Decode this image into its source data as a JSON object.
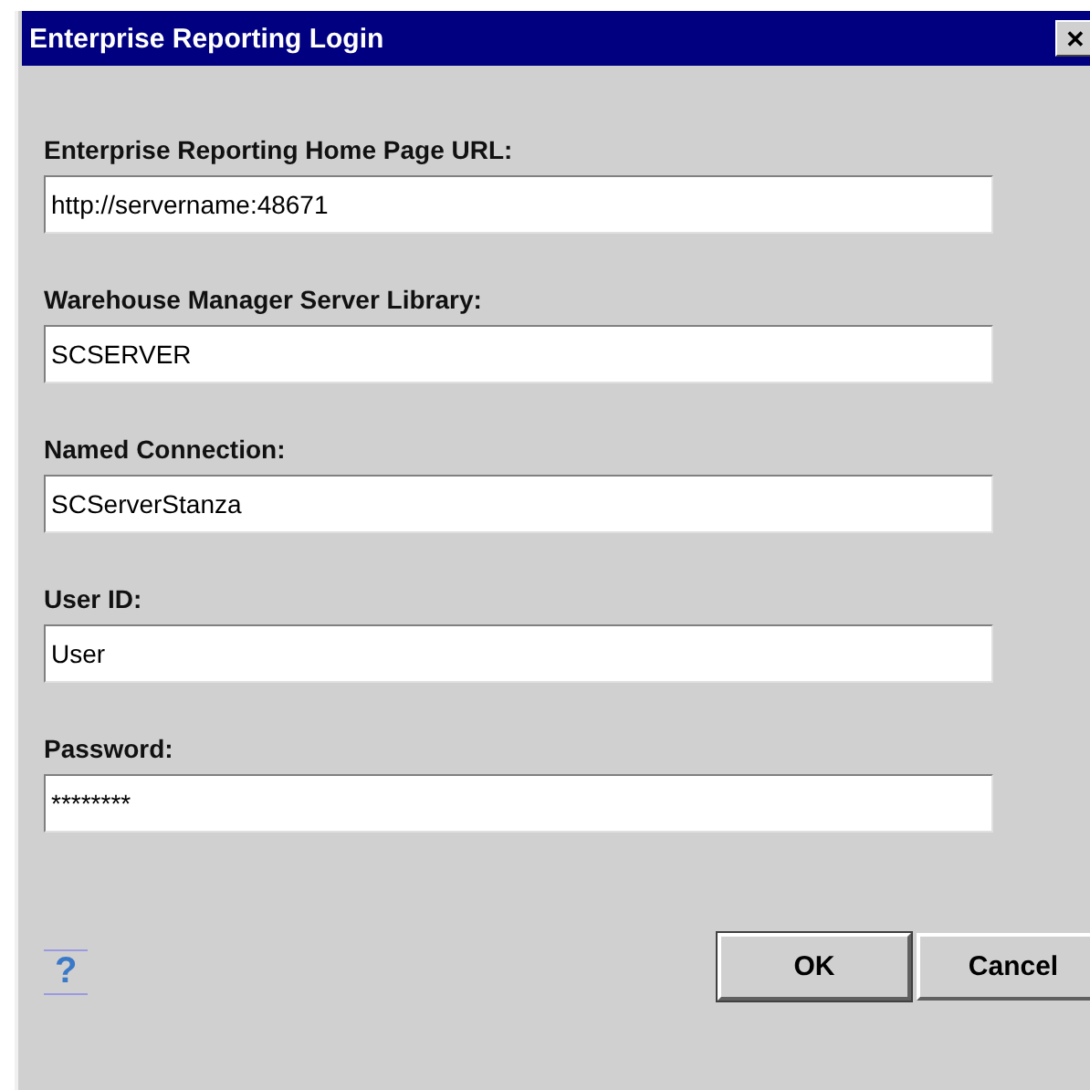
{
  "window": {
    "title": "Enterprise Reporting Login",
    "close": "✕"
  },
  "fields": [
    {
      "label": "Enterprise Reporting Home Page URL:",
      "value": "http://servername:48671"
    },
    {
      "label": "Warehouse Manager Server Library:",
      "value": "SCSERVER"
    },
    {
      "label": "Named Connection:",
      "value": "SCServerStanza"
    },
    {
      "label": "User ID:",
      "value": "User"
    },
    {
      "label": "Password:",
      "value": "********"
    }
  ],
  "help": "?",
  "buttons": [
    {
      "label": "OK",
      "selected": true
    },
    {
      "label": "Cancel",
      "selected": false
    }
  ]
}
